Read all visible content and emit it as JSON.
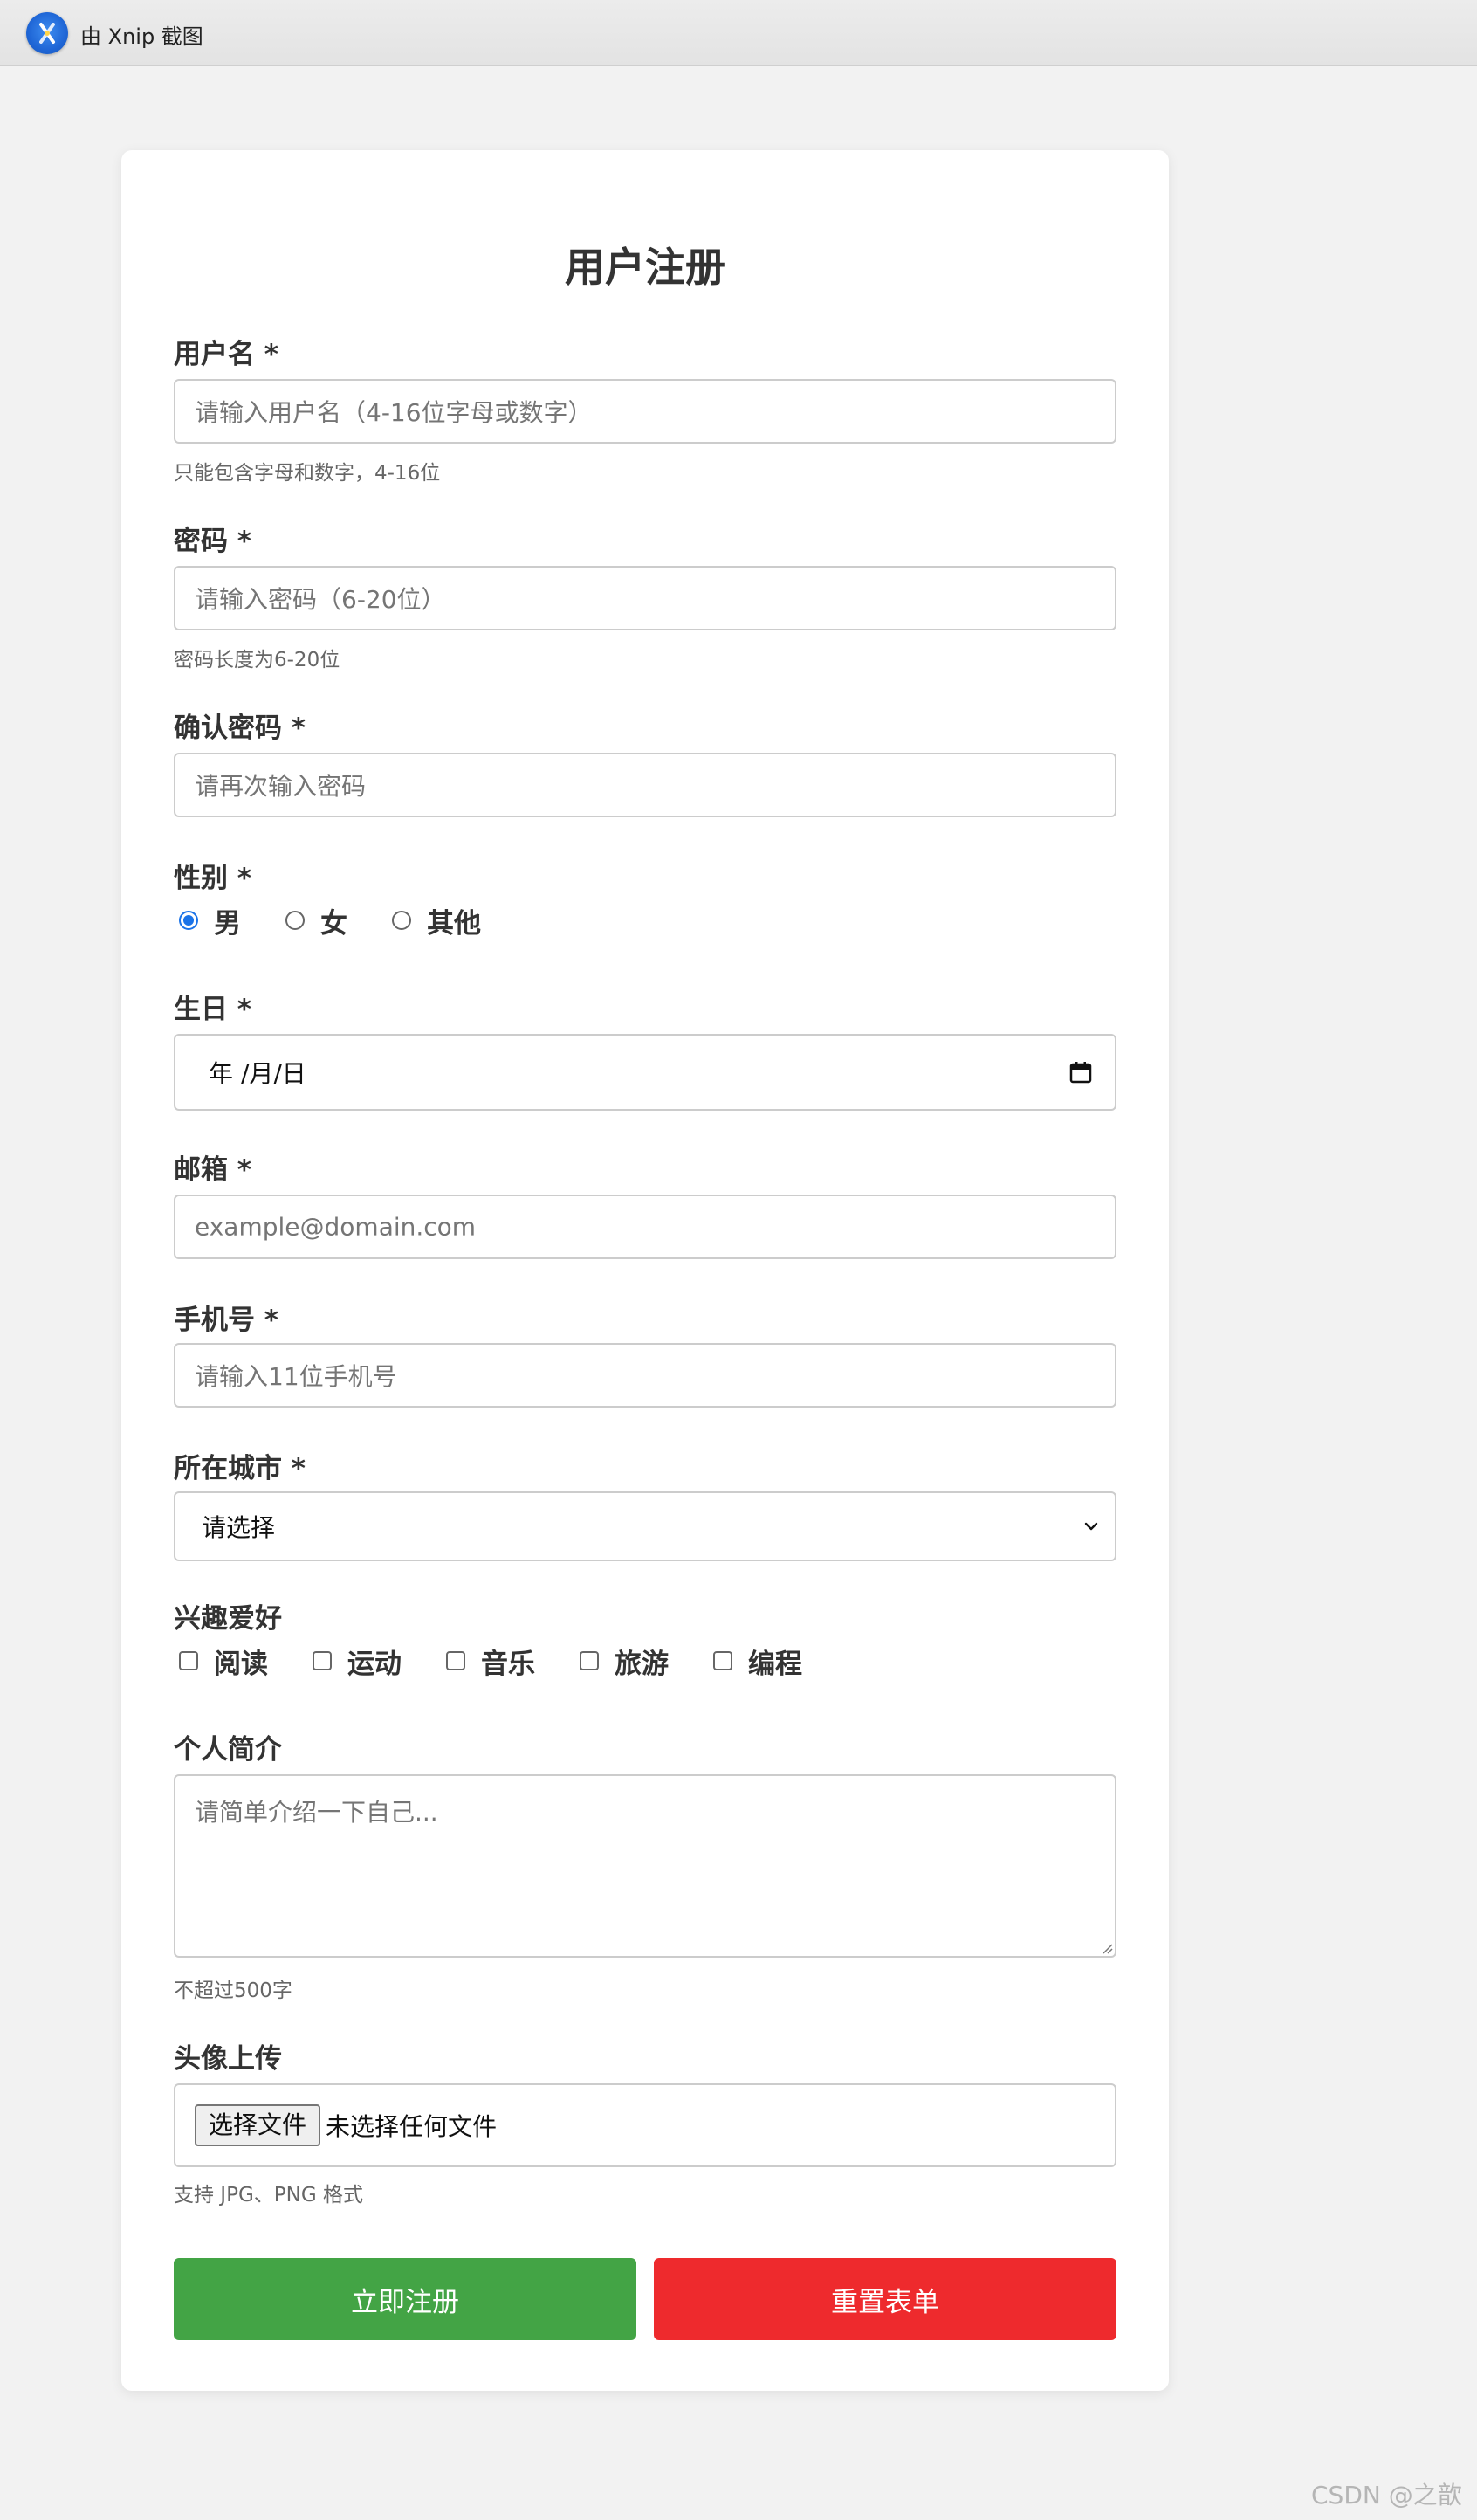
{
  "topbar": {
    "title": "由 Xnip 截图",
    "icon": "xnip-app-icon"
  },
  "form": {
    "title": "用户注册",
    "username": {
      "label": "用户名 *",
      "placeholder": "请输入用户名（4-16位字母或数字）",
      "hint": "只能包含字母和数字，4-16位"
    },
    "password": {
      "label": "密码 *",
      "placeholder": "请输入密码（6-20位）",
      "hint": "密码长度为6-20位"
    },
    "confirm_password": {
      "label": "确认密码 *",
      "placeholder": "请再次输入密码"
    },
    "gender": {
      "label": "性别 *",
      "options": [
        "男",
        "女",
        "其他"
      ],
      "selected": "男"
    },
    "birthday": {
      "label": "生日 *",
      "value": "年 /月/日"
    },
    "email": {
      "label": "邮箱 *",
      "placeholder": "example@domain.com"
    },
    "phone": {
      "label": "手机号 *",
      "placeholder": "请输入11位手机号"
    },
    "city": {
      "label": "所在城市 *",
      "selected": "请选择"
    },
    "hobbies": {
      "label": "兴趣爱好",
      "options": [
        "阅读",
        "运动",
        "音乐",
        "旅游",
        "编程"
      ]
    },
    "bio": {
      "label": "个人简介",
      "placeholder": "请简单介绍一下自己...",
      "hint": "不超过500字"
    },
    "avatar": {
      "label": "头像上传",
      "button": "选择文件",
      "status": "未选择任何文件",
      "hint": "支持 JPG、PNG 格式"
    },
    "actions": {
      "submit": "立即注册",
      "reset": "重置表单"
    }
  },
  "watermark": "CSDN @之歆",
  "colors": {
    "submit": "#43a445",
    "reset": "#ee2a2d",
    "radio_accent": "#1a73e8",
    "page_bg": "#f2f2f2"
  }
}
